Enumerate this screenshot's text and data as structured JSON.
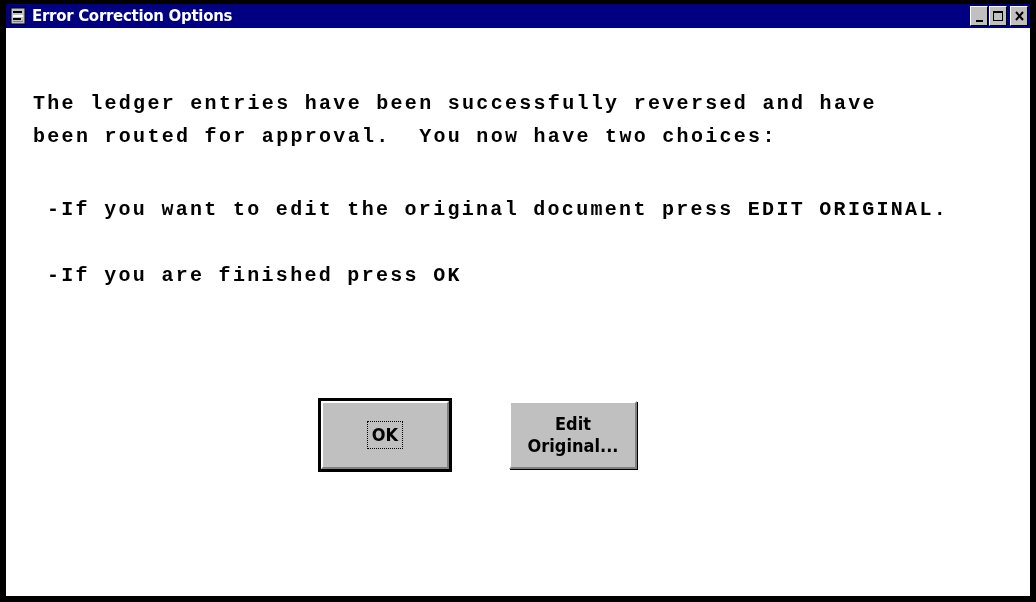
{
  "window": {
    "title": "Error Correction Options"
  },
  "message": [
    {
      "kind": "paragraph",
      "text": "The ledger entries have been successfully reversed and have\nbeen routed for approval.  You now have two choices:"
    },
    {
      "kind": "option",
      "text": "-If you want to edit the original document press EDIT ORIGINAL."
    },
    {
      "kind": "option",
      "text": "-If you are finished press OK"
    }
  ],
  "buttons": [
    {
      "label": "OK",
      "default": true,
      "focused": true
    },
    {
      "label": "Edit\nOriginal...",
      "default": false,
      "focused": false
    }
  ]
}
